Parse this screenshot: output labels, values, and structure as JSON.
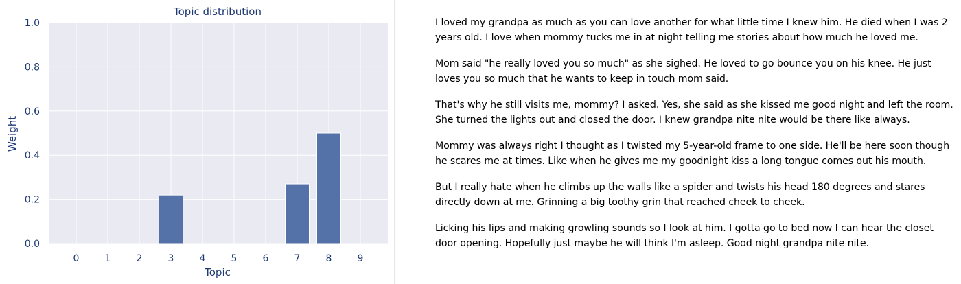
{
  "chart_data": {
    "type": "bar",
    "title": "Topic distribution",
    "xlabel": "Topic",
    "ylabel": "Weight",
    "categories": [
      "0",
      "1",
      "2",
      "3",
      "4",
      "5",
      "6",
      "7",
      "8",
      "9"
    ],
    "values": [
      0,
      0,
      0,
      0.22,
      0,
      0,
      0,
      0.27,
      0.5,
      0
    ],
    "ylim": [
      0,
      1.0
    ],
    "yticks": [
      "0.0",
      "0.2",
      "0.4",
      "0.6",
      "0.8",
      "1.0"
    ],
    "grid": true,
    "colors": {
      "bar": "#5471a8",
      "plot_bg": "#eaeaf2",
      "grid": "#ffffff",
      "text": "#1f3a73"
    }
  },
  "story": {
    "paragraphs": [
      "I loved my grandpa as much as you can love another for what little time I knew him. He died when I was 2 years old. I love when mommy tucks me in at night telling me stories about how much he loved me.",
      "Mom said \"he really loved you so much\" as she sighed. He loved to go bounce you on his knee. He just loves you so much that he wants to keep in touch mom said.",
      "That's why he still visits me, mommy? I asked. Yes, she said as she kissed me good night and left the room. She turned the lights out and closed the door. I knew grandpa nite nite would be there like always.",
      "Mommy was always right I thought as I twisted my 5-year-old frame to one side. He'll be here soon though he scares me at times. Like when he gives me my goodnight kiss a long tongue comes out his mouth.",
      "But I really hate when he climbs up the walls like a spider and twists his head 180 degrees and stares directly down at me. Grinning a big toothy grin that reached cheek to cheek.",
      "Licking his lips and making growling sounds so I look at him. I gotta go to bed now I can hear the closet door opening. Hopefully just maybe he will think I'm asleep. Good night grandpa nite nite."
    ]
  }
}
